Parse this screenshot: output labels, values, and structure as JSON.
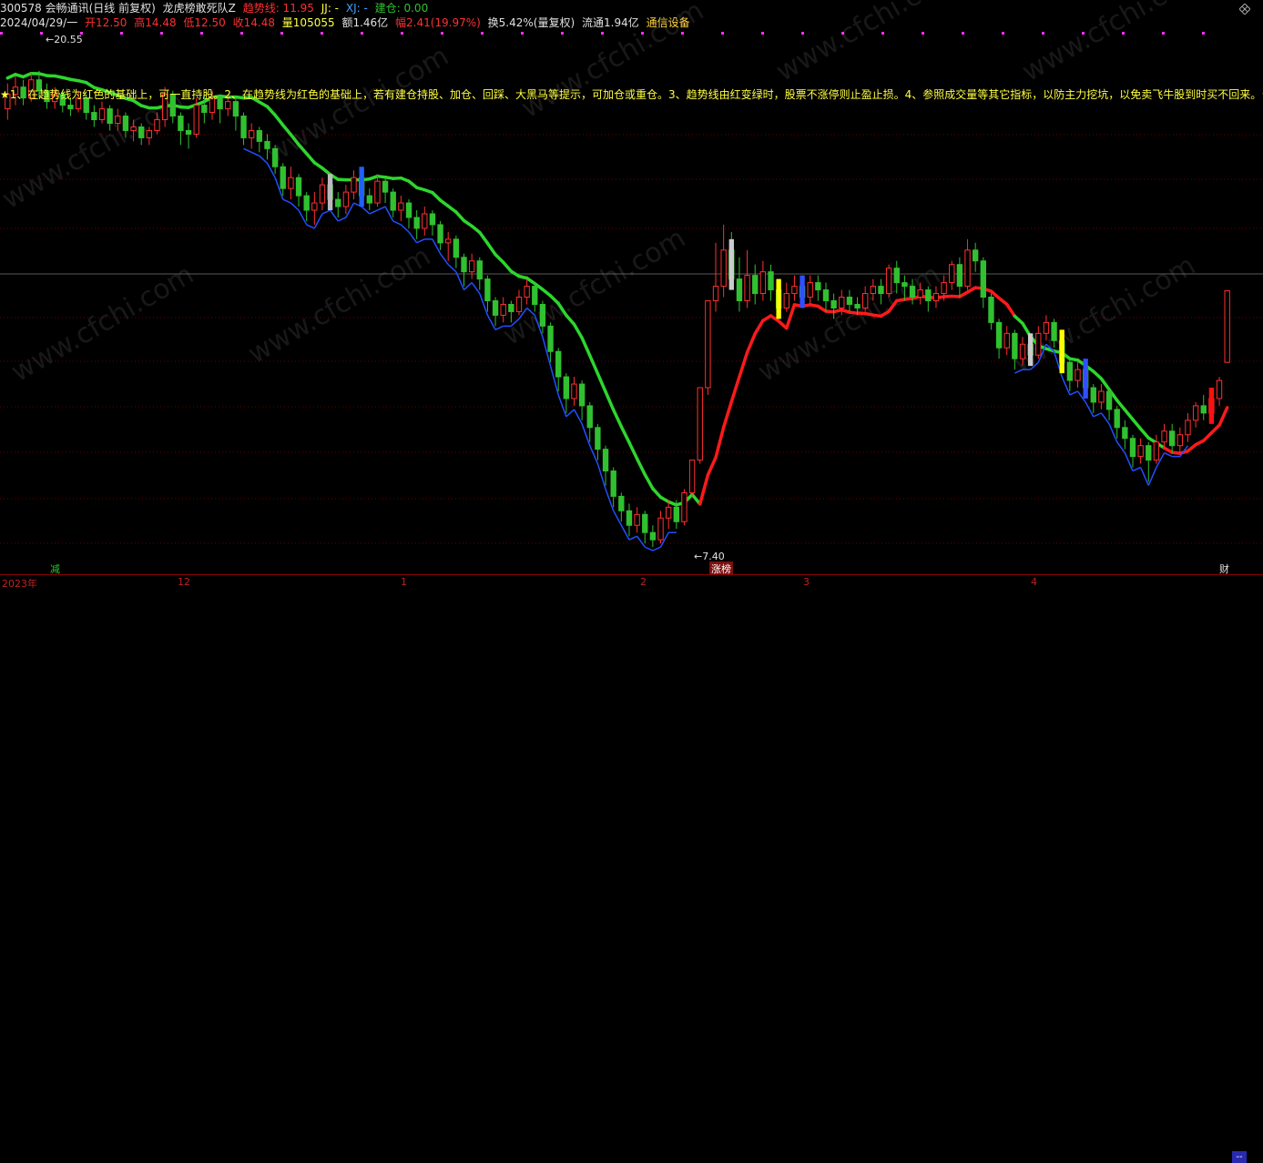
{
  "header": {
    "line1": {
      "code_name": "300578 会畅通讯(日线 前复权)",
      "indicator": "龙虎榜敢死队Z",
      "trend_label": "趋势线: 11.95",
      "jj_label": "JJ: -",
      "xj_label": "XJ: -",
      "build_label": "建仓: 0.00"
    },
    "line2": {
      "date": "2024/04/29/一",
      "open": "开12.50",
      "high": "高14.48",
      "low": "低12.50",
      "close": "收14.48",
      "volume": "量105055",
      "amount": "额1.46亿",
      "change": "幅2.41(19.97%)",
      "turnover": "换5.42%(量复权)",
      "float": "流通1.94亿",
      "sector": "通信设备"
    }
  },
  "note_text": "★1、在趋势线为红色的基础上，可一直持股。2、在趋势线为红色的基础上，若有建仓持股、加仓、回踩、大黑马等提示，可加仓或重仓。3、趋势线由红变绿时，股票不涨停则止盈止损。4、参照成交量等其它指标，以防主力挖坑，以免卖飞牛股到时买不回来。★",
  "watermark": "www.cfchi.com",
  "time_axis": {
    "labels": [
      "2023年",
      "12",
      "1",
      "2",
      "3",
      "4"
    ],
    "markers": [
      "减",
      "涨榜",
      "财"
    ],
    "corner": "--"
  },
  "colors": {
    "up": "#ff3030",
    "down": "#30c030",
    "trend_up": "#ff1a1a",
    "trend_down": "#2dd62d",
    "support": "#2050ff",
    "note": "#ffff40",
    "magenta": "#ff30ff"
  },
  "chart_data": {
    "type": "candlestick",
    "title": "300578 会畅通讯(日线 前复权)",
    "price_marks": {
      "high": "20.55",
      "low": "7.40"
    },
    "ylim": [
      6.8,
      21.6
    ],
    "candles": [
      [
        19.5,
        19.9,
        19.2,
        20.2
      ],
      [
        19.9,
        20.1,
        19.6,
        20.4
      ],
      [
        20.1,
        19.8,
        19.6,
        20.3
      ],
      [
        19.8,
        20.3,
        19.7,
        20.5
      ],
      [
        20.3,
        20.0,
        19.8,
        20.55
      ],
      [
        20.0,
        19.7,
        19.5,
        20.2
      ],
      [
        19.7,
        19.9,
        19.5,
        20.1
      ],
      [
        19.9,
        19.6,
        19.4,
        20.0
      ],
      [
        19.6,
        19.5,
        19.3,
        19.8
      ],
      [
        19.5,
        19.8,
        19.4,
        20.0
      ],
      [
        19.8,
        19.4,
        19.2,
        19.9
      ],
      [
        19.4,
        19.2,
        19.0,
        19.6
      ],
      [
        19.2,
        19.5,
        19.1,
        19.7
      ],
      [
        19.5,
        19.1,
        18.9,
        19.6
      ],
      [
        19.1,
        19.3,
        18.9,
        19.5
      ],
      [
        19.3,
        18.9,
        18.7,
        19.4
      ],
      [
        18.9,
        19.0,
        18.6,
        19.2
      ],
      [
        19.0,
        18.7,
        18.5,
        19.1
      ],
      [
        18.7,
        18.9,
        18.5,
        19.0
      ],
      [
        18.9,
        19.2,
        18.8,
        19.4
      ],
      [
        19.2,
        19.9,
        19.0,
        20.1
      ],
      [
        19.9,
        19.3,
        19.1,
        20.0
      ],
      [
        19.3,
        18.9,
        18.5,
        19.4
      ],
      [
        18.9,
        18.8,
        18.4,
        19.1
      ],
      [
        18.8,
        19.6,
        18.7,
        19.8
      ],
      [
        19.6,
        19.4,
        19.1,
        19.9
      ],
      [
        19.4,
        19.8,
        19.2,
        20.0
      ],
      [
        19.8,
        19.5,
        19.1,
        19.9
      ],
      [
        19.5,
        19.7,
        19.3,
        19.9
      ],
      [
        19.7,
        19.3,
        18.9,
        19.8
      ],
      [
        19.3,
        18.7,
        18.5,
        19.4
      ],
      [
        18.7,
        18.9,
        18.4,
        19.1
      ],
      [
        18.9,
        18.6,
        18.3,
        19.0
      ],
      [
        18.6,
        18.4,
        18.1,
        18.8
      ],
      [
        18.4,
        17.9,
        17.7,
        18.5
      ],
      [
        17.9,
        17.3,
        17.1,
        18.0
      ],
      [
        17.3,
        17.6,
        17.0,
        17.9
      ],
      [
        17.6,
        17.1,
        16.8,
        17.7
      ],
      [
        17.1,
        16.7,
        16.4,
        17.2
      ],
      [
        16.7,
        16.9,
        16.3,
        17.2
      ],
      [
        16.9,
        17.4,
        16.7,
        17.6
      ],
      [
        17.4,
        17.0,
        16.8,
        17.6
      ],
      [
        17.0,
        16.8,
        16.5,
        17.2
      ],
      [
        16.8,
        17.2,
        16.6,
        17.4
      ],
      [
        17.2,
        17.6,
        17.0,
        17.8
      ],
      [
        17.6,
        17.1,
        16.9,
        17.7
      ],
      [
        17.1,
        16.9,
        16.7,
        17.3
      ],
      [
        16.9,
        17.5,
        16.8,
        17.7
      ],
      [
        17.5,
        17.2,
        16.9,
        17.6
      ],
      [
        17.2,
        16.7,
        16.5,
        17.3
      ],
      [
        16.7,
        16.9,
        16.4,
        17.1
      ],
      [
        16.9,
        16.5,
        16.2,
        17.0
      ],
      [
        16.5,
        16.2,
        15.9,
        16.7
      ],
      [
        16.2,
        16.6,
        16.0,
        16.8
      ],
      [
        16.6,
        16.3,
        16.0,
        16.7
      ],
      [
        16.3,
        15.8,
        15.6,
        16.4
      ],
      [
        15.8,
        15.9,
        15.3,
        16.1
      ],
      [
        15.9,
        15.4,
        15.1,
        16.0
      ],
      [
        15.4,
        15.0,
        14.6,
        15.5
      ],
      [
        15.0,
        15.3,
        14.8,
        15.5
      ],
      [
        15.3,
        14.8,
        14.5,
        15.4
      ],
      [
        14.8,
        14.2,
        13.9,
        14.9
      ],
      [
        14.2,
        13.8,
        13.5,
        14.3
      ],
      [
        13.8,
        14.1,
        13.6,
        14.3
      ],
      [
        14.1,
        13.9,
        13.6,
        14.2
      ],
      [
        13.9,
        14.3,
        13.8,
        14.5
      ],
      [
        14.3,
        14.6,
        14.1,
        14.8
      ],
      [
        14.6,
        14.1,
        13.9,
        14.7
      ],
      [
        14.1,
        13.5,
        13.3,
        14.2
      ],
      [
        13.5,
        12.8,
        12.5,
        13.6
      ],
      [
        12.8,
        12.1,
        11.7,
        12.9
      ],
      [
        12.1,
        11.5,
        11.1,
        12.2
      ],
      [
        11.5,
        11.9,
        11.3,
        12.1
      ],
      [
        11.9,
        11.3,
        10.9,
        12.0
      ],
      [
        11.3,
        10.7,
        10.3,
        11.4
      ],
      [
        10.7,
        10.1,
        9.8,
        10.8
      ],
      [
        10.1,
        9.5,
        9.1,
        10.2
      ],
      [
        9.5,
        8.8,
        8.5,
        9.6
      ],
      [
        8.8,
        8.4,
        8.1,
        8.9
      ],
      [
        8.4,
        8.0,
        7.7,
        8.6
      ],
      [
        8.0,
        8.3,
        7.8,
        8.5
      ],
      [
        8.3,
        7.8,
        7.5,
        8.4
      ],
      [
        7.8,
        7.6,
        7.4,
        8.0
      ],
      [
        7.6,
        8.2,
        7.5,
        8.4
      ],
      [
        8.2,
        8.5,
        7.9,
        8.7
      ],
      [
        8.5,
        8.1,
        7.9,
        8.7
      ],
      [
        8.1,
        8.9,
        8.0,
        9.0
      ],
      [
        8.9,
        9.8,
        8.8,
        9.8
      ],
      [
        9.8,
        11.8,
        9.7,
        11.8
      ],
      [
        11.8,
        14.2,
        11.6,
        14.2
      ],
      [
        14.2,
        14.6,
        13.9,
        15.8
      ],
      [
        14.6,
        15.6,
        14.3,
        16.3
      ],
      [
        15.6,
        14.8,
        14.5,
        16.1
      ],
      [
        14.8,
        14.2,
        13.9,
        15.4
      ],
      [
        14.2,
        14.9,
        14.0,
        15.6
      ],
      [
        14.9,
        14.4,
        14.1,
        15.2
      ],
      [
        14.4,
        15.0,
        14.2,
        15.3
      ],
      [
        15.0,
        14.5,
        14.2,
        15.2
      ],
      [
        14.5,
        14.0,
        13.8,
        14.8
      ],
      [
        14.0,
        14.4,
        13.9,
        14.7
      ],
      [
        14.4,
        14.6,
        14.2,
        14.9
      ],
      [
        14.6,
        14.3,
        14.1,
        14.8
      ],
      [
        14.3,
        14.7,
        14.1,
        14.9
      ],
      [
        14.7,
        14.5,
        14.2,
        14.9
      ],
      [
        14.5,
        14.2,
        13.9,
        14.7
      ],
      [
        14.2,
        14.0,
        13.7,
        14.4
      ],
      [
        14.0,
        14.3,
        13.8,
        14.5
      ],
      [
        14.3,
        14.1,
        13.9,
        14.5
      ],
      [
        14.1,
        14.0,
        13.8,
        14.3
      ],
      [
        14.0,
        14.4,
        13.9,
        14.6
      ],
      [
        14.4,
        14.6,
        14.2,
        14.8
      ],
      [
        14.6,
        14.4,
        14.1,
        14.8
      ],
      [
        14.4,
        15.1,
        14.3,
        15.2
      ],
      [
        15.1,
        14.7,
        14.4,
        15.3
      ],
      [
        14.7,
        14.6,
        14.2,
        14.9
      ],
      [
        14.6,
        14.3,
        14.1,
        14.8
      ],
      [
        14.3,
        14.5,
        14.1,
        14.7
      ],
      [
        14.5,
        14.2,
        13.9,
        14.6
      ],
      [
        14.2,
        14.4,
        14.0,
        14.6
      ],
      [
        14.4,
        14.7,
        14.2,
        14.9
      ],
      [
        14.7,
        15.2,
        14.5,
        15.3
      ],
      [
        15.2,
        14.6,
        14.3,
        15.4
      ],
      [
        14.6,
        15.6,
        14.5,
        15.9
      ],
      [
        15.6,
        15.3,
        15.0,
        15.8
      ],
      [
        15.3,
        14.3,
        14.0,
        15.4
      ],
      [
        14.3,
        13.6,
        13.4,
        14.4
      ],
      [
        13.6,
        12.9,
        12.6,
        13.7
      ],
      [
        12.9,
        13.3,
        12.7,
        13.5
      ],
      [
        13.3,
        12.6,
        12.3,
        13.4
      ],
      [
        12.6,
        13.0,
        12.4,
        13.2
      ],
      [
        13.0,
        12.7,
        12.4,
        13.2
      ],
      [
        12.7,
        13.3,
        12.6,
        13.5
      ],
      [
        13.3,
        13.6,
        13.1,
        13.8
      ],
      [
        13.6,
        13.1,
        12.9,
        13.7
      ],
      [
        13.1,
        12.5,
        12.2,
        13.2
      ],
      [
        12.5,
        12.0,
        11.7,
        12.6
      ],
      [
        12.0,
        12.3,
        11.8,
        12.5
      ],
      [
        12.3,
        11.8,
        11.5,
        12.4
      ],
      [
        11.8,
        11.4,
        11.1,
        11.9
      ],
      [
        11.4,
        11.7,
        11.2,
        11.9
      ],
      [
        11.7,
        11.2,
        10.9,
        11.8
      ],
      [
        11.2,
        10.7,
        10.4,
        11.3
      ],
      [
        10.7,
        10.4,
        10.1,
        10.9
      ],
      [
        10.4,
        9.9,
        9.6,
        10.5
      ],
      [
        9.9,
        10.2,
        9.7,
        10.4
      ],
      [
        10.2,
        9.8,
        9.2,
        10.3
      ],
      [
        9.8,
        10.3,
        9.7,
        10.5
      ],
      [
        10.3,
        10.6,
        10.1,
        10.8
      ],
      [
        10.6,
        10.2,
        10.0,
        10.8
      ],
      [
        10.2,
        10.5,
        10.0,
        10.7
      ],
      [
        10.5,
        10.9,
        10.3,
        11.1
      ],
      [
        10.9,
        11.3,
        10.7,
        11.4
      ],
      [
        11.3,
        11.1,
        10.9,
        11.6
      ],
      [
        11.1,
        11.5,
        10.9,
        11.7
      ],
      [
        11.5,
        12.0,
        11.3,
        12.1
      ],
      [
        12.5,
        14.48,
        12.5,
        14.48
      ]
    ]
  }
}
